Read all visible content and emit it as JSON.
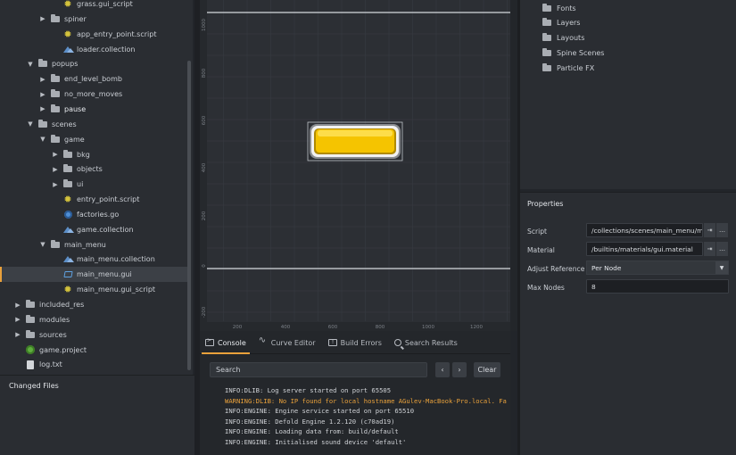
{
  "assets": {
    "items": [
      {
        "label": "grass.gui_script",
        "indent": 3,
        "arrow": "",
        "icon": "gear"
      },
      {
        "label": "spiner",
        "indent": 2,
        "arrow": "right",
        "icon": "folder"
      },
      {
        "label": "app_entry_point.script",
        "indent": 3,
        "arrow": "",
        "icon": "gear"
      },
      {
        "label": "loader.collection",
        "indent": 3,
        "arrow": "",
        "icon": "collection"
      },
      {
        "label": "popups",
        "indent": 1,
        "arrow": "down",
        "icon": "folder"
      },
      {
        "label": "end_level_bomb",
        "indent": 2,
        "arrow": "right",
        "icon": "folder"
      },
      {
        "label": "no_more_moves",
        "indent": 2,
        "arrow": "right",
        "icon": "folder"
      },
      {
        "label": "pause",
        "indent": 2,
        "arrow": "right",
        "icon": "folder",
        "bold": true
      },
      {
        "label": "scenes",
        "indent": 1,
        "arrow": "down",
        "icon": "folder"
      },
      {
        "label": "game",
        "indent": 2,
        "arrow": "down",
        "icon": "folder"
      },
      {
        "label": "bkg",
        "indent": 3,
        "arrow": "right",
        "icon": "folder"
      },
      {
        "label": "objects",
        "indent": 3,
        "arrow": "right",
        "icon": "folder"
      },
      {
        "label": "ui",
        "indent": 3,
        "arrow": "right",
        "icon": "folder"
      },
      {
        "label": "entry_point.script",
        "indent": 3,
        "arrow": "",
        "icon": "gear"
      },
      {
        "label": "factories.go",
        "indent": 3,
        "arrow": "",
        "icon": "go"
      },
      {
        "label": "game.collection",
        "indent": 3,
        "arrow": "",
        "icon": "collection"
      },
      {
        "label": "main_menu",
        "indent": 2,
        "arrow": "down",
        "icon": "folder"
      },
      {
        "label": "main_menu.collection",
        "indent": 3,
        "arrow": "",
        "icon": "collection"
      },
      {
        "label": "main_menu.gui",
        "indent": 3,
        "arrow": "",
        "icon": "gui",
        "selected": true
      },
      {
        "label": "main_menu.gui_script",
        "indent": 3,
        "arrow": "",
        "icon": "gear"
      },
      {
        "label": "included_res",
        "indent": 0,
        "arrow": "right",
        "icon": "folder"
      },
      {
        "label": "modules",
        "indent": 0,
        "arrow": "right",
        "icon": "folder"
      },
      {
        "label": "sources",
        "indent": 0,
        "arrow": "right",
        "icon": "folder"
      },
      {
        "label": "game.project",
        "indent": 0,
        "arrow": "",
        "icon": "project"
      },
      {
        "label": "log.txt",
        "indent": 0,
        "arrow": "",
        "icon": "text"
      }
    ]
  },
  "changed_files": {
    "title": "Changed Files"
  },
  "scene": {
    "y_ticks": [
      "1000",
      "800",
      "600",
      "400",
      "200",
      "0",
      "-200"
    ],
    "x_ticks": [
      "200",
      "400",
      "600",
      "800",
      "1000",
      "1200"
    ],
    "button_color": "#f5c400"
  },
  "bottom_tabs": [
    {
      "label": "Console",
      "icon": "console-icon",
      "active": true
    },
    {
      "label": "Curve Editor",
      "icon": "curve-icon"
    },
    {
      "label": "Build Errors",
      "icon": "build-errors-icon"
    },
    {
      "label": "Search Results",
      "icon": "search-results-icon"
    }
  ],
  "console": {
    "search_placeholder": "Search",
    "prev": "‹",
    "next": "›",
    "clear": "Clear",
    "lines": [
      {
        "text": "INFO:DLIB: Log server started on port 65505",
        "warn": false
      },
      {
        "text": "WARNING:DLIB: No IP found for local hostname AGulev-MacBook-Pro.local. Fa",
        "warn": true
      },
      {
        "text": "INFO:ENGINE: Engine service started on port 65510",
        "warn": false
      },
      {
        "text": "INFO:ENGINE: Defold Engine 1.2.120 (c70ad19)",
        "warn": false
      },
      {
        "text": "INFO:ENGINE: Loading data from: build/default",
        "warn": false
      },
      {
        "text": "INFO:ENGINE: Initialised sound device 'default'",
        "warn": false
      }
    ]
  },
  "outline": {
    "items": [
      "Fonts",
      "Layers",
      "Layouts",
      "Spine Scenes",
      "Particle FX"
    ]
  },
  "properties": {
    "title": "Properties",
    "script_label": "Script",
    "script_value": "/collections/scenes/main_menu/ma",
    "material_label": "Material",
    "material_value": "/builtins/materials/gui.material",
    "adjust_label": "Adjust Reference",
    "adjust_value": "Per Node",
    "max_nodes_label": "Max Nodes",
    "max_nodes_value": "8",
    "goto_glyph": "⇥",
    "browse_glyph": "…"
  },
  "colors": {
    "accent": "#e9a13b",
    "warning": "#e9a13b"
  }
}
